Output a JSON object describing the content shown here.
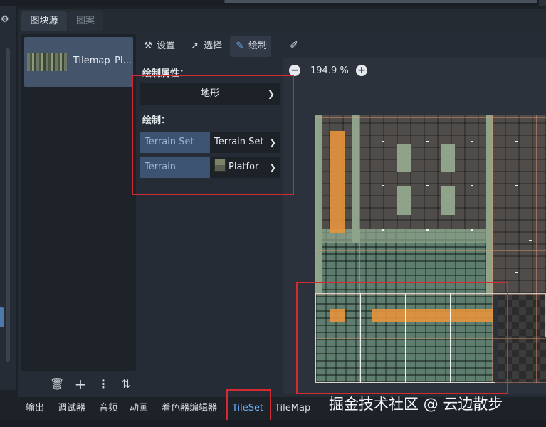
{
  "tabs": [
    {
      "label": "图块源",
      "active": true
    },
    {
      "label": "图案",
      "active": false
    }
  ],
  "sources": {
    "items": [
      {
        "label": "Tilemap_Pl..."
      }
    ]
  },
  "source_tools": [
    "trash-icon",
    "add-icon",
    "more-icon",
    "sort-icon"
  ],
  "mode_toolbar": {
    "setup": "设置",
    "select": "选择",
    "paint": "绘制",
    "selected": "paint"
  },
  "paint_props": {
    "title": "绘制属性：",
    "mode_value": "地形",
    "draw_title": "绘制：",
    "terrain_set_label": "Terrain Set",
    "terrain_set_value": "Terrain Set",
    "terrain_label": "Terrain",
    "terrain_value": "Platfor"
  },
  "zoom": {
    "value": "194.9 %"
  },
  "bottom_tabs": [
    {
      "label": "输出",
      "active": false
    },
    {
      "label": "调试器",
      "active": false
    },
    {
      "label": "音频",
      "active": false
    },
    {
      "label": "动画",
      "active": false
    },
    {
      "label": "着色器编辑器",
      "active": false
    },
    {
      "label": "TileSet",
      "active": true
    },
    {
      "label": "TileMap",
      "active": false
    }
  ],
  "watermark": "掘金技术社区 @ 云边散步",
  "colors": {
    "highlight": "#d42a32",
    "accent": "#6fb0ff",
    "terrain_paint": "#e5953c"
  }
}
